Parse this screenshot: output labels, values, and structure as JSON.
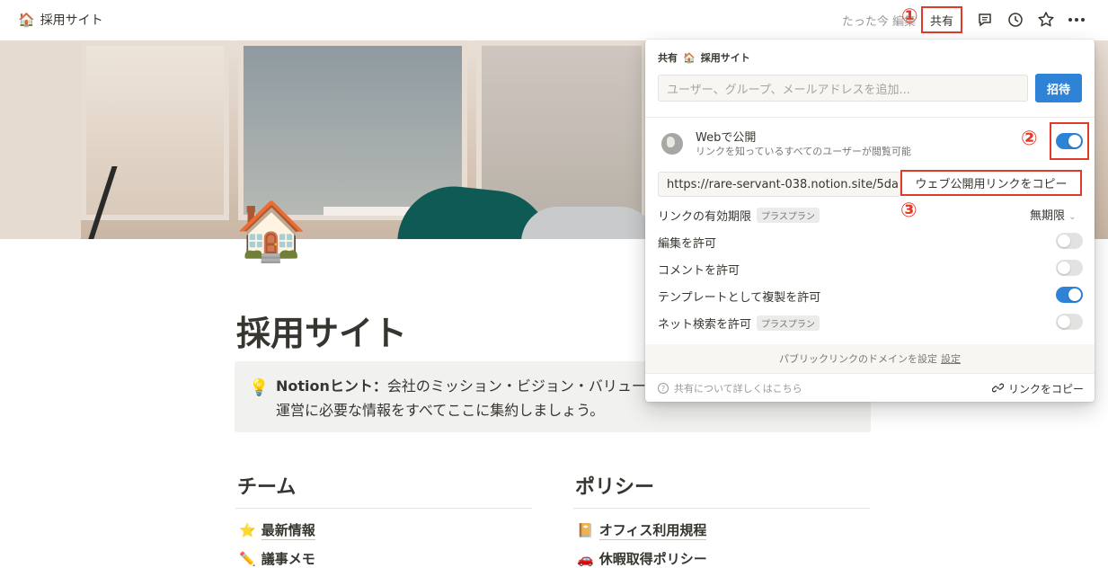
{
  "topbar": {
    "breadcrumb_emoji": "🏠",
    "breadcrumb_title": "採用サイト",
    "edited_text": "たった今 編集",
    "share_label": "共有"
  },
  "markers": {
    "m1": "①",
    "m2": "②",
    "m3": "③"
  },
  "page": {
    "icon": "🏠",
    "title": "採用サイト",
    "callout_emoji": "💡",
    "callout_bold": "Notionヒント：",
    "callout_line1": "会社のミッション・ビジョン・バリューか",
    "callout_line2": "運営に必要な情報をすべてここに集約しましょう。"
  },
  "columns": {
    "team": {
      "heading": "チーム",
      "items": [
        {
          "emoji": "⭐",
          "label": "最新情報"
        },
        {
          "emoji": "✏️",
          "label": "議事メモ"
        }
      ]
    },
    "policy": {
      "heading": "ポリシー",
      "items": [
        {
          "emoji": "📔",
          "label": "オフィス利用規程"
        },
        {
          "emoji": "🚗",
          "label": "休暇取得ポリシー"
        }
      ]
    }
  },
  "share_popup": {
    "header_label": "共有",
    "header_emoji": "🏠",
    "header_page": "採用サイト",
    "invite_placeholder": "ユーザー、グループ、メールアドレスを追加...",
    "invite_button": "招待",
    "web_title": "Webで公開",
    "web_subtitle": "リンクを知っているすべてのユーザーが閲覧可能",
    "web_published": true,
    "url": "https://rare-servant-038.notion.site/5da",
    "copy_web_link": "ウェブ公開用リンクをコピー",
    "options": [
      {
        "label": "リンクの有効期限",
        "badge": "プラスプラン",
        "value": "無期限"
      },
      {
        "label": "編集を許可",
        "enabled": false
      },
      {
        "label": "コメントを許可",
        "enabled": false
      },
      {
        "label": "テンプレートとして複製を許可",
        "enabled": true
      },
      {
        "label": "ネット検索を許可",
        "badge": "プラスプラン",
        "enabled": false
      }
    ],
    "domain_text": "パブリックリンクのドメインを設定",
    "domain_link": "設定",
    "help_text": "共有について詳しくはこちら",
    "copy_link": "リンクをコピー"
  },
  "colors": {
    "accent_blue": "#2e83d7",
    "highlight_red": "#e03a2b"
  }
}
